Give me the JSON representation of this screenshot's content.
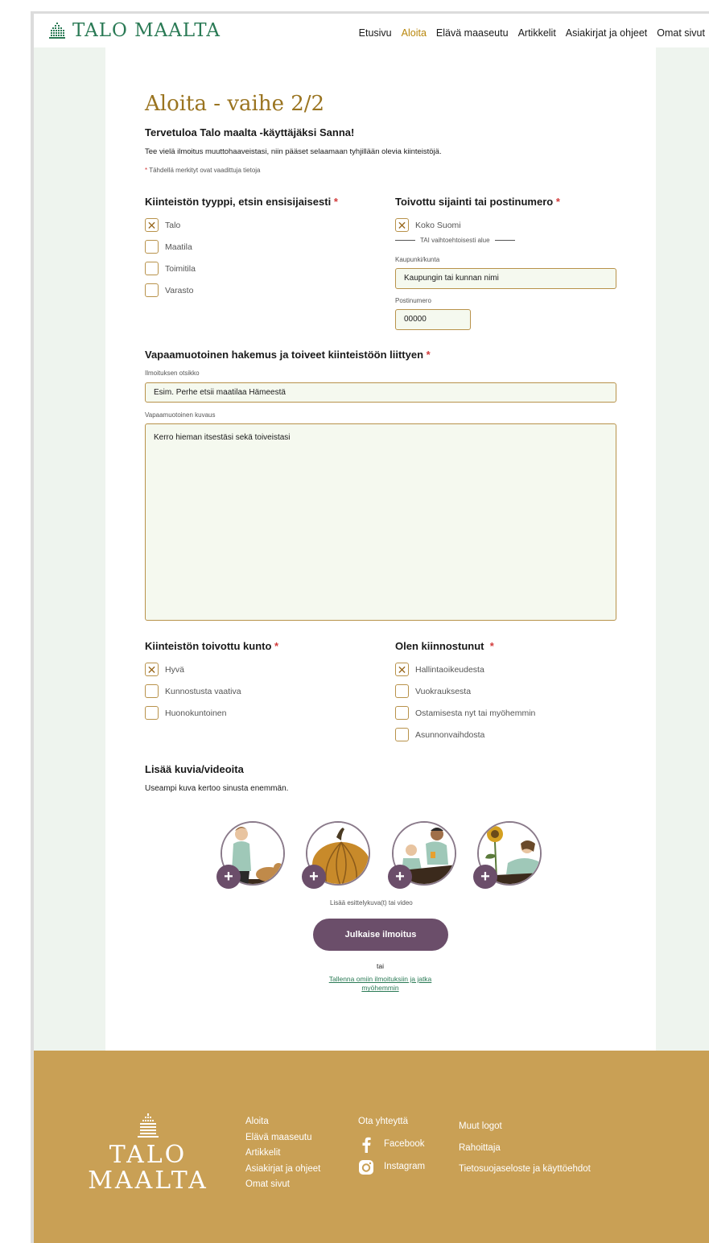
{
  "header": {
    "logo": "TALO MAALTA",
    "nav": [
      "Etusivu",
      "Aloita",
      "Elävä maaseutu",
      "Artikkelit",
      "Asiakirjat ja ohjeet",
      "Omat sivut"
    ],
    "active_nav": "Aloita"
  },
  "page": {
    "title": "Aloita - vaihe 2/2",
    "welcome": "Tervetuloa Talo maalta -käyttäjäksi Sanna!",
    "intro": "Tee vielä ilmoitus muuttohaaveistasi, niin pääset selaamaan tyhjillään olevia kiinteistöjä.",
    "required_note": "Tähdellä merkityt ovat vaadittuja tietoja",
    "required_mark": "*"
  },
  "property_type": {
    "heading": "Kiinteistön tyyppi, etsin ensisijaisesti",
    "options": [
      {
        "label": "Talo",
        "checked": true
      },
      {
        "label": "Maatila",
        "checked": false
      },
      {
        "label": "Toimitila",
        "checked": false
      },
      {
        "label": "Varasto",
        "checked": false
      }
    ]
  },
  "location": {
    "heading": "Toivottu sijainti tai postinumero",
    "whole_finland": {
      "label": "Koko Suomi",
      "checked": true
    },
    "alt_divider": "TAI vaihtoehtoisesti alue",
    "city_label": "Kaupunki/kunta",
    "city_placeholder": "Kaupungin tai kunnan nimi",
    "zip_label": "Postinumero",
    "zip_placeholder": "00000"
  },
  "application": {
    "heading": "Vapaamuotoinen hakemus ja toiveet kiinteistöön liittyen",
    "title_label": "Ilmoituksen otsikko",
    "title_placeholder": "Esim. Perhe etsii maatilaa Hämeestä",
    "desc_label": "Vapaamuotoinen kuvaus",
    "desc_placeholder": "Kerro hieman itsestäsi sekä toiveistasi"
  },
  "condition": {
    "heading": "Kiinteistön toivottu kunto",
    "options": [
      {
        "label": "Hyvä",
        "checked": true
      },
      {
        "label": "Kunnostusta vaativa",
        "checked": false
      },
      {
        "label": "Huonokuntoinen",
        "checked": false
      }
    ]
  },
  "interest": {
    "heading": "Olen kiinnostunut",
    "options": [
      {
        "label": "Hallintaoikeudesta",
        "checked": true
      },
      {
        "label": "Vuokrauksesta",
        "checked": false
      },
      {
        "label": "Ostamisesta nyt tai myöhemmin",
        "checked": false
      },
      {
        "label": "Asunnonvaihdosta",
        "checked": false
      }
    ]
  },
  "media": {
    "heading": "Lisää kuvia/videoita",
    "subtext": "Useampi kuva kertoo sinusta enemmän.",
    "caption": "Lisää esittelykuva(t) tai video",
    "plus": "+"
  },
  "actions": {
    "publish": "Julkaise ilmoitus",
    "or": "tai",
    "save_link": "Tallenna omiin ilmoituksiin ja jatka myöhemmin"
  },
  "footer": {
    "logo_line1": "TALO",
    "logo_line2": "MAALTA",
    "links": [
      "Aloita",
      "Elävä maaseutu",
      "Artikkelit",
      "Asiakirjat ja ohjeet",
      "Omat sivut"
    ],
    "contact_heading": "Ota yhteyttä",
    "facebook": "Facebook",
    "instagram": "Instagram",
    "other": [
      "Muut logot",
      "Rahoittaja",
      "Tietosuojaseloste ja käyttöehdot"
    ]
  },
  "colors": {
    "brand_green": "#2a7a55",
    "gold": "#9a7420",
    "accent_purple": "#6b4e6a",
    "footer_bg": "#c9a055",
    "required": "#d23b3b"
  }
}
